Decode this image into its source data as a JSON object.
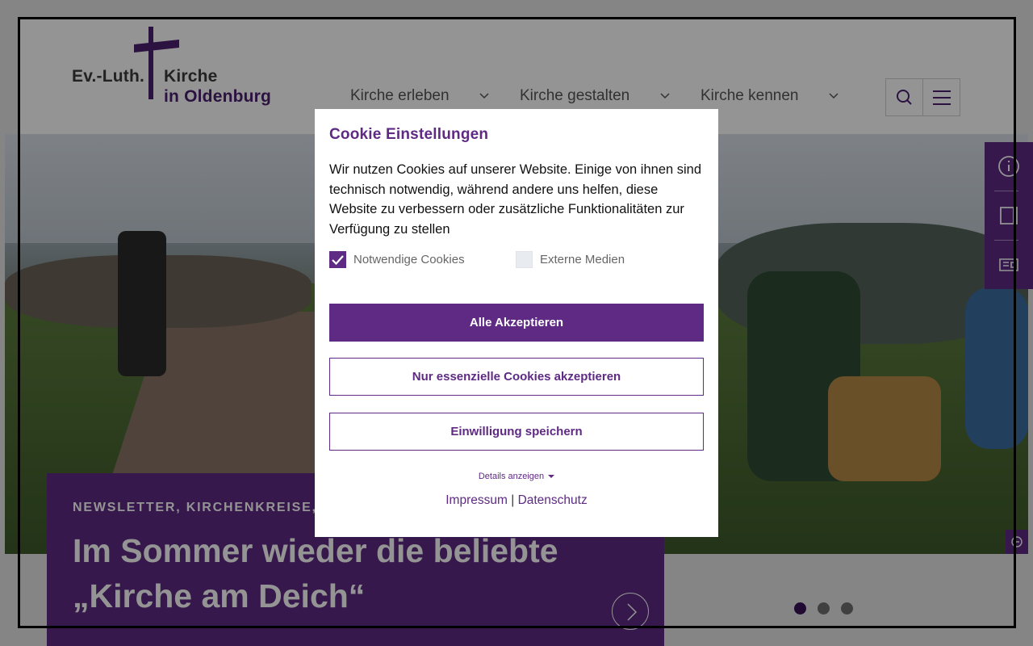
{
  "logo": {
    "line1_left": "Ev.-Luth.",
    "line1_right": "Kirche",
    "line2": "in Oldenburg"
  },
  "nav": {
    "items": [
      {
        "label": "Kirche erleben"
      },
      {
        "label": "Kirche gestalten"
      },
      {
        "label": "Kirche kennen"
      }
    ]
  },
  "header_tools": {
    "search_icon": "search-icon",
    "menu_icon": "hamburger-icon"
  },
  "side_tabs": [
    "info-icon",
    "book-icon",
    "newspaper-icon"
  ],
  "teaser": {
    "tags": "NEWSLETTER, KIRCHENKREISE, K",
    "title": "Im Sommer wieder die beliebte „Kirche am Deich“"
  },
  "slider": {
    "dot_count": 3,
    "active_index": 0
  },
  "cookie": {
    "title": "Cookie Einstellungen",
    "text": "Wir nutzen Cookies auf unserer Website. Einige von ihnen sind technisch notwendig, während andere uns helfen, diese Website zu verbessern oder zusätzliche Funktionalitäten zur Verfügung zu stellen",
    "options": [
      {
        "label": "Notwendige Cookies",
        "checked": true
      },
      {
        "label": "Externe Medien",
        "checked": false
      }
    ],
    "buttons": {
      "accept_all": "Alle Akzeptieren",
      "essential_only": "Nur essenzielle Cookies akzeptieren",
      "save": "Einwilligung speichern"
    },
    "details": "Details anzeigen",
    "links": {
      "impressum": "Impressum",
      "separator": "|",
      "datenschutz": "Datenschutz"
    }
  },
  "colors": {
    "brand_purple": "#5e2a83",
    "dark_purple": "#3a1256",
    "overlay": "rgba(0,0,0,0.42)"
  }
}
